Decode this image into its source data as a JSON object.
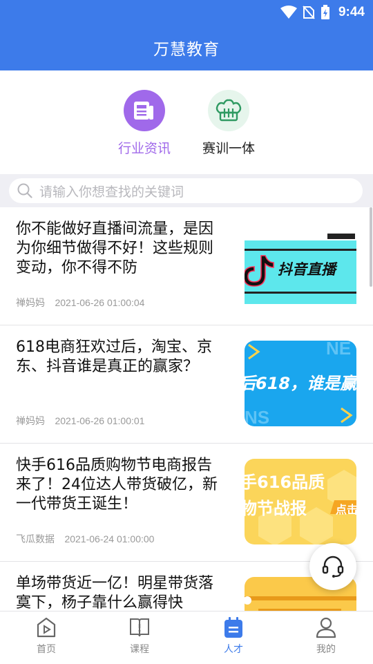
{
  "status": {
    "time": "9:44"
  },
  "app": {
    "title": "万慧教育"
  },
  "categories": [
    {
      "label": "行业资讯",
      "color": "#a069ea",
      "icon": "news-icon"
    },
    {
      "label": "赛训一体",
      "color": "#333333",
      "icon": "chef-hat-icon"
    }
  ],
  "search": {
    "placeholder": "请输入你想查找的关键词"
  },
  "articles": [
    {
      "title": "你不能做好直播间流量，是因为你细节做得不好！这些规则变动，你不得不防",
      "author": "禅妈妈",
      "date": "2021-06-26 01:00:04",
      "thumb_text": "抖音直播"
    },
    {
      "title": "618电商狂欢过后，淘宝、京东、抖音谁是真正的赢家？",
      "author": "禅妈妈",
      "date": "2021-06-26 01:00:01",
      "thumb_text": "后618，谁是赢"
    },
    {
      "title": "快手616品质购物节电商报告来了！24位达人带货破亿，新一代带货王诞生！",
      "author": "飞瓜数据",
      "date": "2021-06-24 01:00:00",
      "thumb_text_1": "手616品质",
      "thumb_text_2": "物节战报",
      "thumb_text_3": "点击"
    },
    {
      "title": "单场带货近一亿！明星带货落寞下，杨子靠什么赢得快",
      "author": "",
      "date": ""
    }
  ],
  "tabs": [
    {
      "label": "首页",
      "icon": "home-play-icon"
    },
    {
      "label": "课程",
      "icon": "book-icon"
    },
    {
      "label": "人才",
      "icon": "talent-icon",
      "active": true
    },
    {
      "label": "我的",
      "icon": "person-icon"
    }
  ],
  "colors": {
    "primary": "#3d7bea",
    "category_active": "#a069ea"
  }
}
